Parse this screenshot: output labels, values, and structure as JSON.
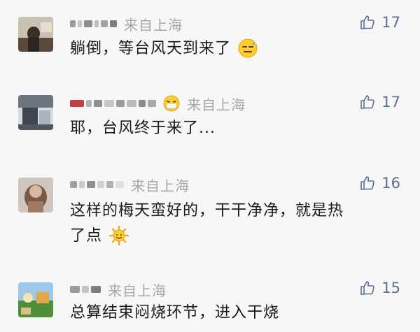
{
  "comments": [
    {
      "location": "来自上海",
      "likes": "17",
      "text": "躺倒，等台风天到来了",
      "emoji": "sweat-smile-emoji"
    },
    {
      "location": "来自上海",
      "likes": "17",
      "text": "耶，台风终于来了...",
      "name_emoji": "mask-face-emoji"
    },
    {
      "location": "来自上海",
      "likes": "16",
      "text_line1": "这样的梅天蛮好的，干干净净，就是热",
      "text_line2": "了点",
      "emoji": "sun-emoji"
    },
    {
      "location": "来自上海",
      "likes": "15",
      "text": "总算结束闷烧环节，进入干烧"
    }
  ],
  "colors": {
    "background": "#f7f7f7",
    "location_text": "#a6a6a6",
    "like_accent": "#5a6e92",
    "body_text": "#1a1a1a"
  }
}
